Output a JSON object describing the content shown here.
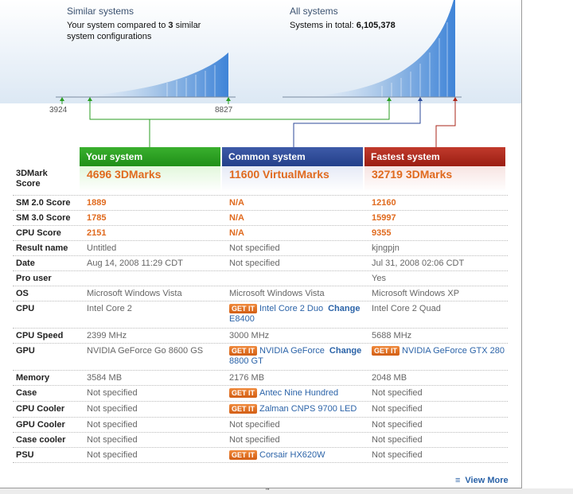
{
  "similar": {
    "heading": "Similar systems",
    "desc_prefix": "Your system compared to ",
    "count": "3",
    "desc_suffix": " similar system configurations",
    "tick_min": "3924",
    "tick_max": "8827"
  },
  "all": {
    "heading": "All systems",
    "desc_prefix": "Systems in total: ",
    "total": "6,105,378"
  },
  "columns": {
    "yours": "Your system",
    "common": "Common system",
    "fastest": "Fastest system"
  },
  "colors": {
    "yours": "#2a9e22",
    "common": "#2c4a99",
    "fastest": "#aa2518",
    "score": "#e06a1e",
    "link": "#2b63a8"
  },
  "getit_label": "GET IT",
  "change_label": "Change",
  "rows": [
    {
      "label": "3DMark Score",
      "yours": "4696 3DMarks",
      "common": "11600 VirtualMarks",
      "fastest": "32719 3DMarks"
    },
    {
      "label": "SM 2.0 Score",
      "yours": "1889",
      "common": "N/A",
      "fastest": "12160"
    },
    {
      "label": "SM 3.0 Score",
      "yours": "1785",
      "common": "N/A",
      "fastest": "15997"
    },
    {
      "label": "CPU Score",
      "yours": "2151",
      "common": "N/A",
      "fastest": "9355"
    },
    {
      "label": "Result name",
      "yours": "Untitled",
      "common": "Not specified",
      "fastest": "kjngpjn"
    },
    {
      "label": "Date",
      "yours": "Aug 14, 2008 11:29 CDT",
      "common": "Not specified",
      "fastest": "Jul 31, 2008 02:06 CDT"
    },
    {
      "label": "Pro user",
      "yours": "",
      "common": "",
      "fastest": "Yes"
    },
    {
      "label": "OS",
      "yours": "Microsoft Windows Vista",
      "common": "Microsoft Windows Vista",
      "fastest": "Microsoft Windows XP"
    },
    {
      "label": "CPU",
      "yours": "Intel Core 2",
      "common": "Intel Core 2 Duo",
      "common_extra": "E8400",
      "fastest": "Intel Core 2 Quad"
    },
    {
      "label": "CPU Speed",
      "yours": "2399 MHz",
      "common": "3000 MHz",
      "fastest": "5688 MHz"
    },
    {
      "label": "GPU",
      "yours": "NVIDIA GeForce Go 8600 GS",
      "common": "NVIDIA GeForce",
      "common_extra": "8800 GT",
      "fastest": "NVIDIA GeForce GTX 280"
    },
    {
      "label": "Memory",
      "yours": "3584 MB",
      "common": "2176 MB",
      "fastest": "2048 MB"
    },
    {
      "label": "Case",
      "yours": "Not specified",
      "common": "Antec Nine Hundred",
      "fastest": "Not specified"
    },
    {
      "label": "CPU Cooler",
      "yours": "Not specified",
      "common": "Zalman CNPS 9700 LED",
      "fastest": "Not specified"
    },
    {
      "label": "GPU Cooler",
      "yours": "Not specified",
      "common": "Not specified",
      "fastest": "Not specified"
    },
    {
      "label": "Case cooler",
      "yours": "Not specified",
      "common": "Not specified",
      "fastest": "Not specified"
    },
    {
      "label": "PSU",
      "yours": "Not specified",
      "common": "Corsair HX620W",
      "fastest": "Not specified"
    }
  ],
  "view_more": "View More",
  "grip_glyph": "'''"
}
